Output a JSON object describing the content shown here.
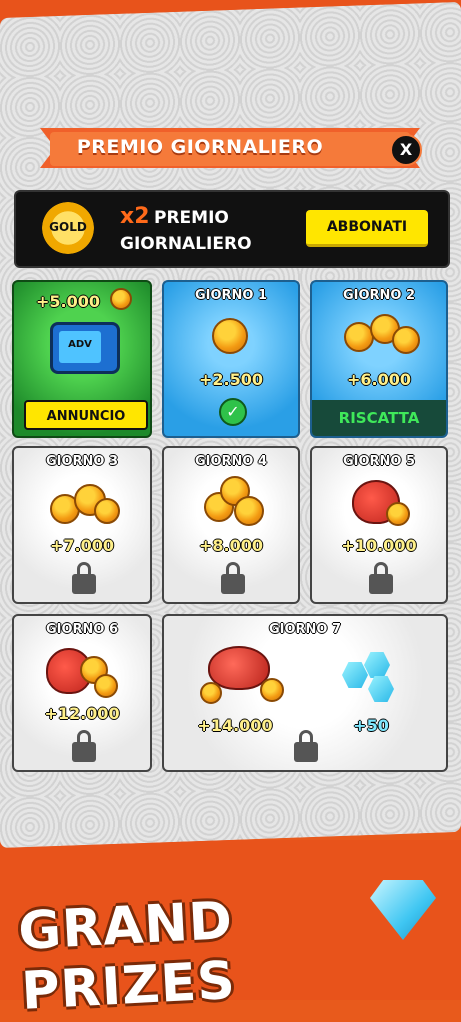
{
  "header": {
    "title": "PREMIO GIORNALIERO",
    "close_label": "X"
  },
  "gold_banner": {
    "badge": "GOLD",
    "multiplier": "x2",
    "line1": "PREMIO",
    "line2": "GIORNALIERO",
    "button": "ABBONATI"
  },
  "ad_card": {
    "amount": "+5.000",
    "tv_label": "ADV",
    "button": "ANNUNCIO"
  },
  "days": [
    {
      "label": "GIORNO 1",
      "amount": "+2.500",
      "status": "claimed"
    },
    {
      "label": "GIORNO 2",
      "amount": "+6.000",
      "status": "available",
      "button": "RISCATTA"
    },
    {
      "label": "GIORNO 3",
      "amount": "+7.000",
      "status": "locked"
    },
    {
      "label": "GIORNO 4",
      "amount": "+8.000",
      "status": "locked"
    },
    {
      "label": "GIORNO 5",
      "amount": "+10.000",
      "status": "locked"
    },
    {
      "label": "GIORNO 6",
      "amount": "+12.000",
      "status": "locked"
    },
    {
      "label": "GIORNO 7",
      "amount": "+14.000",
      "gems": "+50",
      "status": "locked"
    }
  ],
  "footer": {
    "banner": "GRAND PRIZES"
  }
}
